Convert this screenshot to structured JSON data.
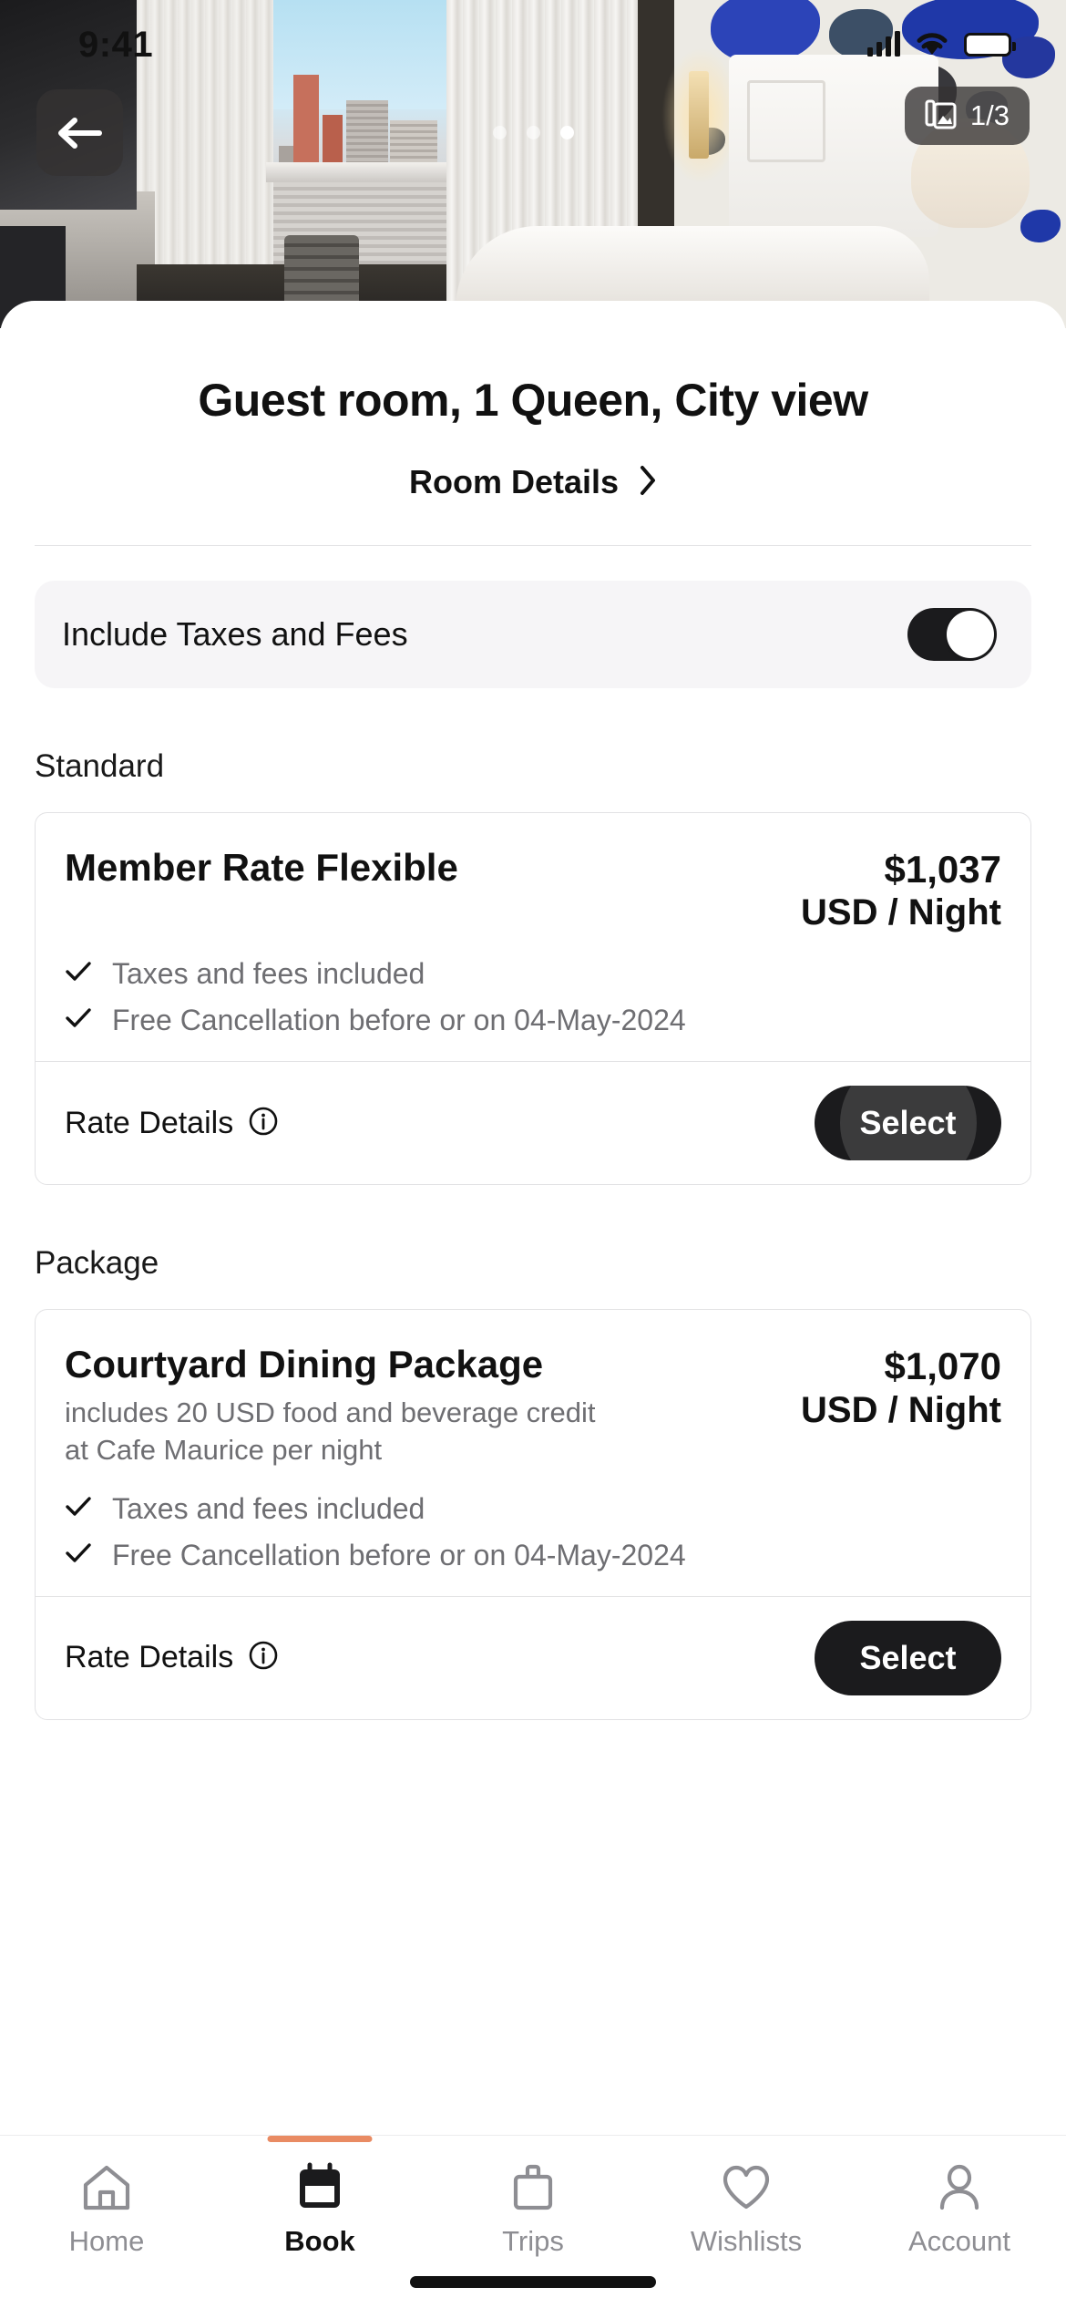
{
  "status_bar": {
    "time": "9:41",
    "icons": [
      "cellular-signal-icon",
      "wifi-icon",
      "battery-icon"
    ]
  },
  "hero": {
    "back_icon": "back-arrow-icon",
    "gallery_icon": "photo-gallery-icon",
    "image_counter": "1/3",
    "dots_total": 3,
    "active_dot_index": 2
  },
  "header": {
    "title": "Guest room, 1 Queen, City view",
    "room_details_label": "Room Details",
    "chevron_icon": "chevron-right-icon"
  },
  "taxes_toggle": {
    "label": "Include Taxes and Fees",
    "state": "on"
  },
  "sections": [
    {
      "label": "Standard",
      "rates": [
        {
          "name": "Member Rate Flexible",
          "description": "",
          "price": "$1,037",
          "price_unit": "USD / Night",
          "perks": [
            "Taxes and fees included",
            "Free Cancellation before or on 04-May-2024"
          ],
          "rate_details_label": "Rate Details",
          "info_icon": "info-circle-icon",
          "select_label": "Select",
          "select_pressed": true
        }
      ]
    },
    {
      "label": "Package",
      "rates": [
        {
          "name": "Courtyard Dining Package",
          "description": "includes 20 USD food and beverage credit at Cafe Maurice per night",
          "price": "$1,070",
          "price_unit": "USD / Night",
          "perks": [
            "Taxes and fees included",
            "Free Cancellation before or on 04-May-2024"
          ],
          "rate_details_label": "Rate Details",
          "info_icon": "info-circle-icon",
          "select_label": "Select",
          "select_pressed": false
        }
      ]
    }
  ],
  "tab_bar": {
    "active_index": 1,
    "accent_color": "#E98B63",
    "items": [
      {
        "label": "Home",
        "icon": "home-icon"
      },
      {
        "label": "Book",
        "icon": "calendar-icon"
      },
      {
        "label": "Trips",
        "icon": "briefcase-icon"
      },
      {
        "label": "Wishlists",
        "icon": "heart-icon"
      },
      {
        "label": "Account",
        "icon": "person-icon"
      }
    ]
  },
  "colors": {
    "accent": "#E98B63",
    "primary_dark": "#1b1b1d",
    "muted_text": "#6e6e72",
    "card_border": "#e2e2e4",
    "toggle_bg": "#f6f5f7"
  }
}
